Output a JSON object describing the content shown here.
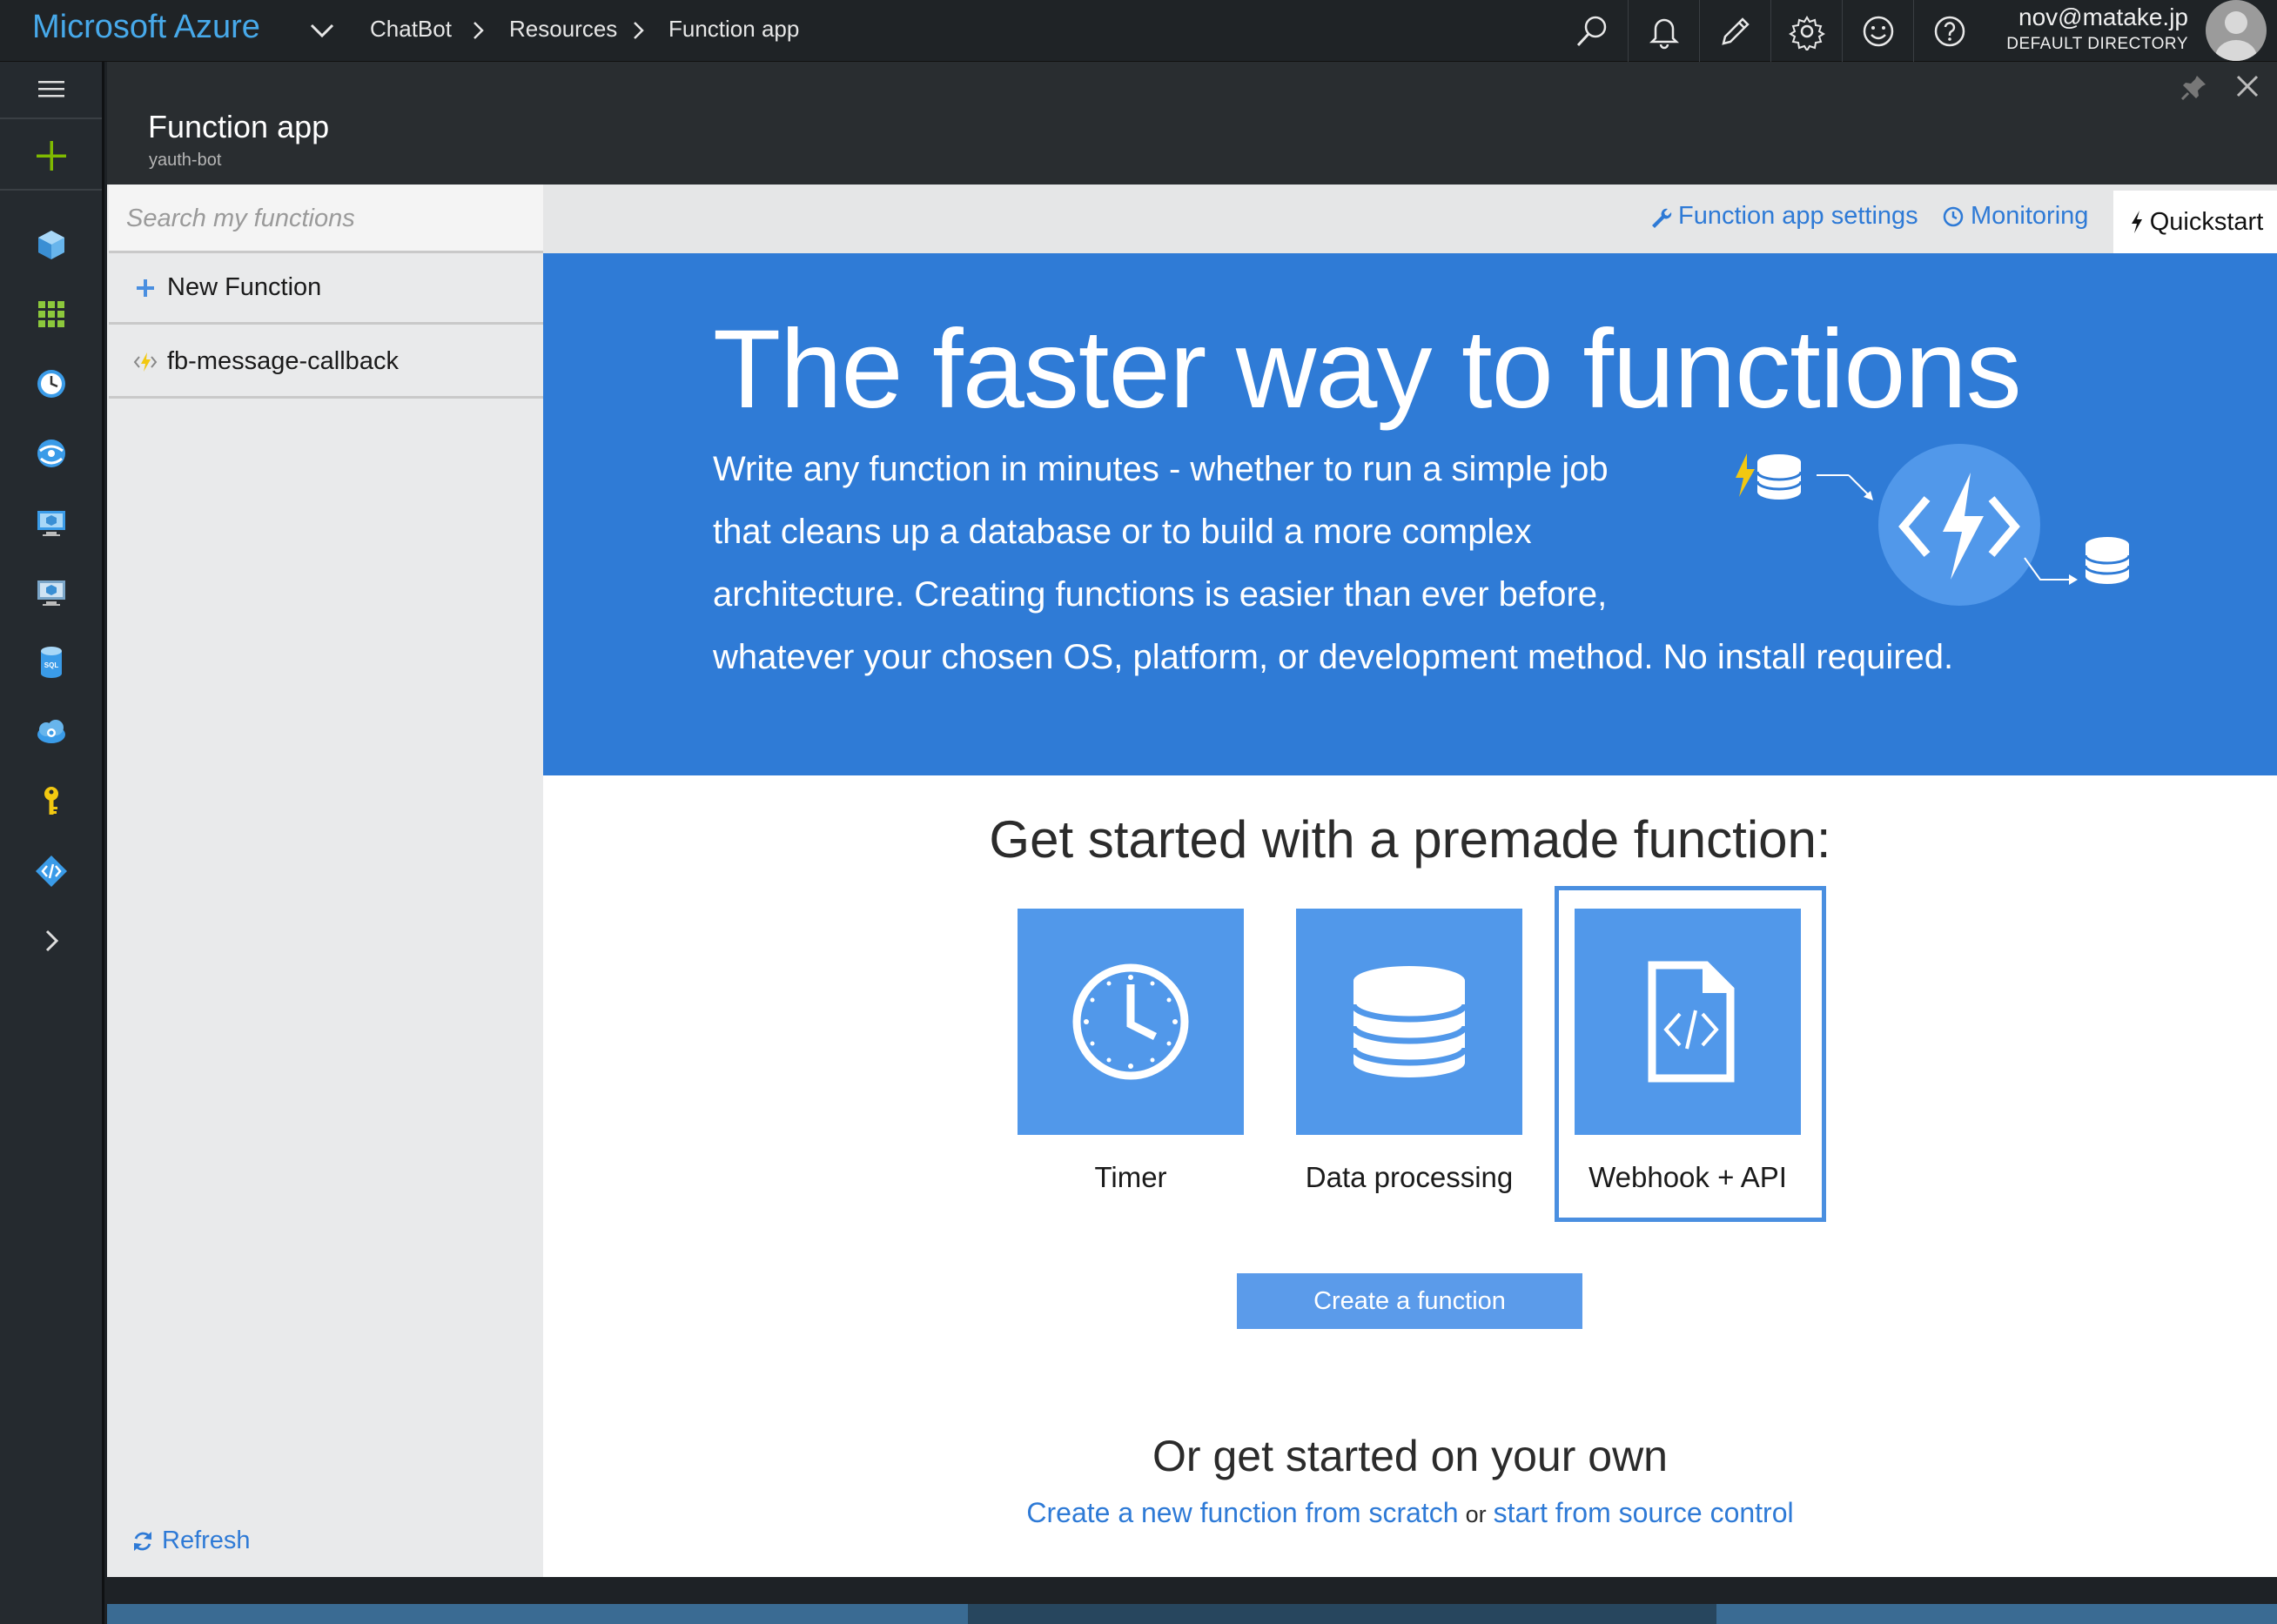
{
  "topbar": {
    "brand": "Microsoft Azure",
    "breadcrumbs": [
      "ChatBot",
      "Resources",
      "Function app"
    ],
    "icons": [
      "search-icon",
      "bell-icon",
      "pencil-icon",
      "gear-icon",
      "smiley-icon",
      "help-icon"
    ],
    "user": {
      "email": "nov@matake.jp",
      "directory": "DEFAULT DIRECTORY"
    }
  },
  "leftnav": {
    "items": [
      "menu-icon",
      "new-plus-icon",
      "resource-groups-icon",
      "all-resources-icon",
      "recent-clock-icon",
      "app-services-icon",
      "virtual-machines-icon",
      "cloud-services-icon",
      "sql-databases-icon",
      "cloud-settings-icon",
      "key-icon",
      "api-app-icon",
      "more-chevron-icon"
    ]
  },
  "blade": {
    "title": "Function app",
    "subtitle": "yauth-bot"
  },
  "functions_panel": {
    "search_placeholder": "Search my functions",
    "new_function_label": "New Function",
    "functions": [
      "fb-message-callback"
    ],
    "refresh_label": "Refresh"
  },
  "commandbar": {
    "settings_label": "Function app settings",
    "monitoring_label": "Monitoring",
    "quickstart_label": "Quickstart"
  },
  "hero": {
    "title": "The faster way to functions",
    "lines": [
      "Write any function in minutes - whether to run a simple job",
      "that cleans up a database or to build a more complex",
      "architecture. Creating functions is easier than ever before,",
      "whatever your chosen OS, platform, or development method. No install required."
    ]
  },
  "premade": {
    "title": "Get started with a premade function:",
    "tiles": [
      {
        "label": "Timer",
        "icon": "clock-icon"
      },
      {
        "label": "Data processing",
        "icon": "database-icon"
      },
      {
        "label": "Webhook + API",
        "icon": "code-file-icon"
      }
    ],
    "selected": "Webhook + API",
    "create_button": "Create a function"
  },
  "own": {
    "title": "Or get started on your own",
    "link_scratch": "Create a new function from scratch",
    "or": "or",
    "link_source": "start from source control"
  },
  "colors": {
    "brand": "#47a9ea",
    "hero_bg": "#2f7bd6",
    "tile_bg": "#5198ea",
    "link": "#2e7ad6"
  }
}
